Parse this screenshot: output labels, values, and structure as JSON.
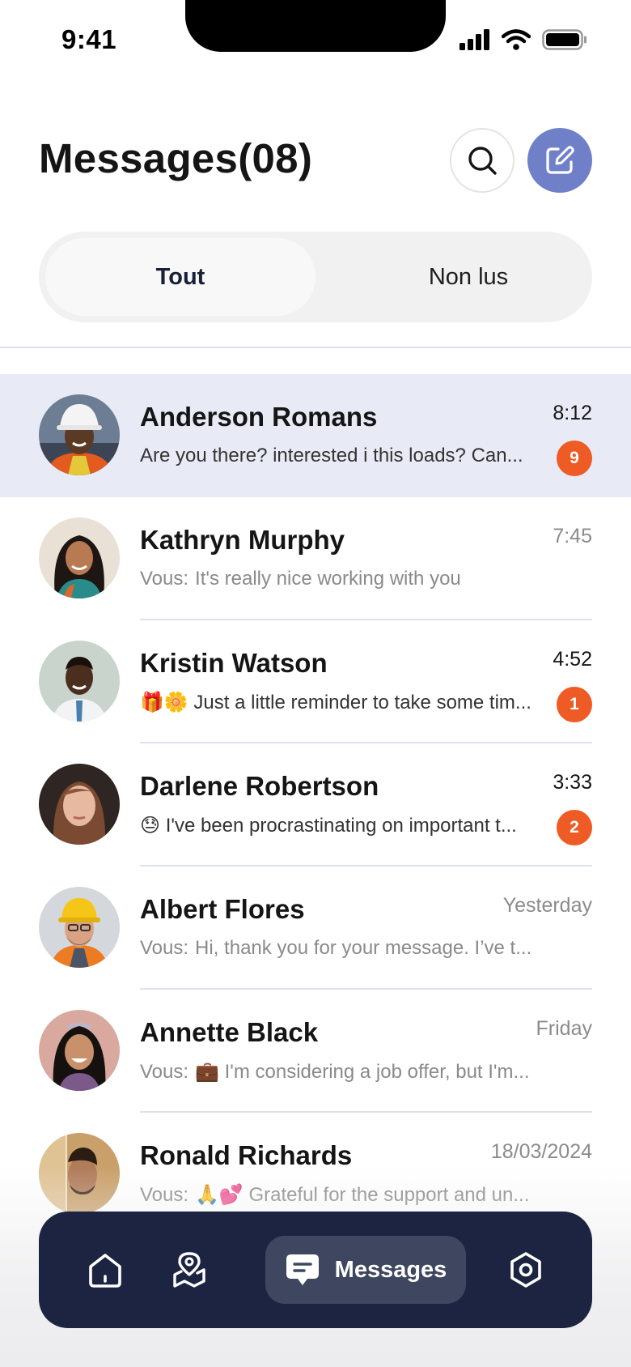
{
  "status_bar": {
    "time": "9:41"
  },
  "header": {
    "title": "Messages(08)"
  },
  "tabs": {
    "all": "Tout",
    "unread": "Non lus"
  },
  "conversations": [
    {
      "name": "Anderson Romans",
      "time": "8:12",
      "preview": "Are you there?  interested i this loads? Can...",
      "badge": "9",
      "active": true,
      "you": ""
    },
    {
      "name": "Kathryn Murphy",
      "time": "7:45",
      "you": "Vous:",
      "preview": "It's really nice working with you",
      "badge": ""
    },
    {
      "name": "Kristin Watson",
      "time": "4:52",
      "preview": "🎁🌼 Just a little reminder to take some tim...",
      "badge": "1",
      "you": ""
    },
    {
      "name": "Darlene Robertson",
      "time": "3:33",
      "preview": "😓 I've been procrastinating on important t...",
      "badge": "2",
      "you": ""
    },
    {
      "name": "Albert Flores",
      "time": "Yesterday",
      "you": "Vous:",
      "preview": "Hi, thank you for your message. I’ve t...",
      "badge": ""
    },
    {
      "name": "Annette Black",
      "time": "Friday",
      "you": "Vous:",
      "preview": "💼 I'm considering a job offer, but I'm...",
      "badge": ""
    },
    {
      "name": "Ronald Richards",
      "time": "18/03/2024",
      "you": "Vous:",
      "preview": "🙏💕 Grateful for the support and un...",
      "badge": ""
    }
  ],
  "bottom_nav": {
    "messages_label": "Messages"
  },
  "colors": {
    "accent": "#7080c8",
    "nav_bg": "#1c2442",
    "badge": "#ef5b25",
    "active_row": "#e8ebf6"
  },
  "icons": [
    "search-icon",
    "compose-icon",
    "home-icon",
    "map-pin-icon",
    "chat-icon",
    "settings-icon"
  ]
}
